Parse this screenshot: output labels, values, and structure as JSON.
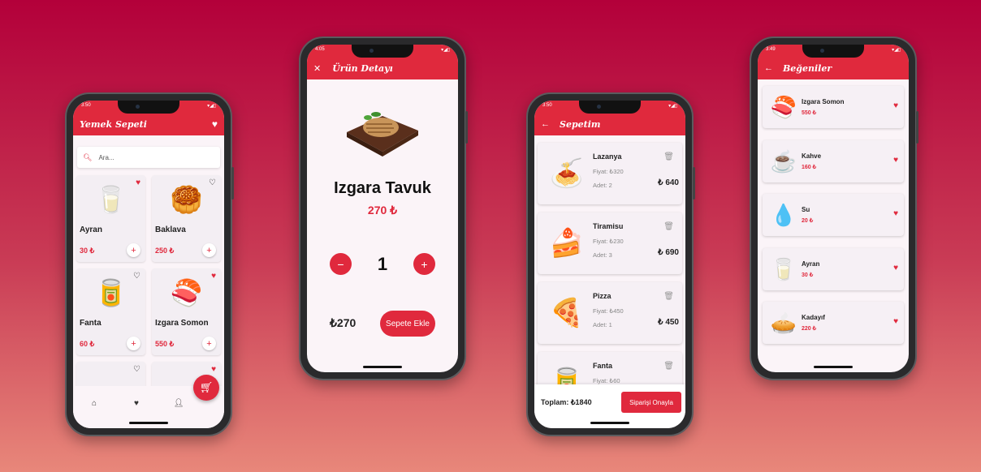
{
  "colors": {
    "accent": "#e0293d",
    "bg_top": "#b3003a",
    "bg_bottom": "#e8877a"
  },
  "home": {
    "status_time": "3:50",
    "title": "Yemek Sepeti",
    "search_placeholder": "Ara...",
    "products": [
      {
        "name": "Ayran",
        "price": "30 ₺",
        "fav": true,
        "icon": "ayran-cup-icon",
        "glyph": "🥛"
      },
      {
        "name": "Baklava",
        "price": "250 ₺",
        "fav": false,
        "icon": "baklava-icon",
        "glyph": "🥮"
      },
      {
        "name": "Fanta",
        "price": "60 ₺",
        "fav": false,
        "icon": "fanta-can-icon",
        "glyph": "🥫"
      },
      {
        "name": "Izgara Somon",
        "price": "550 ₺",
        "fav": true,
        "icon": "salmon-plate-icon",
        "glyph": "🍣"
      }
    ],
    "nav": [
      "home-icon",
      "favorites-icon",
      "profile-icon"
    ]
  },
  "detail": {
    "status_time": "4:05",
    "title": "Ürün Detayı",
    "name": "Izgara Tavuk",
    "price": "270 ₺",
    "quantity": "1",
    "total": "₺270",
    "add_label": "Sepete Ekle"
  },
  "cart": {
    "status_time": "3:50",
    "title": "Sepetim",
    "items": [
      {
        "name": "Lazanya",
        "price": "Fiyat: ₺320",
        "qty": "Adet: 2",
        "total": "₺ 640",
        "glyph": "🍝"
      },
      {
        "name": "Tiramisu",
        "price": "Fiyat: ₺230",
        "qty": "Adet: 3",
        "total": "₺ 690",
        "glyph": "🍰"
      },
      {
        "name": "Pizza",
        "price": "Fiyat: ₺450",
        "qty": "Adet: 1",
        "total": "₺ 450",
        "glyph": "🍕"
      },
      {
        "name": "Fanta",
        "price": "Fiyat: ₺60",
        "qty": "",
        "total": "",
        "glyph": "🥫"
      }
    ],
    "total": "Toplam: ₺1840",
    "confirm_label": "Siparişi Onayla"
  },
  "favorites": {
    "status_time": "3:49",
    "title": "Beğeniler",
    "items": [
      {
        "name": "Izgara Somon",
        "price": "550 ₺",
        "glyph": "🍣"
      },
      {
        "name": "Kahve",
        "price": "160 ₺",
        "glyph": "☕"
      },
      {
        "name": "Su",
        "price": "20 ₺",
        "glyph": "💧"
      },
      {
        "name": "Ayran",
        "price": "30 ₺",
        "glyph": "🥛"
      },
      {
        "name": "Kadayıf",
        "price": "220 ₺",
        "glyph": "🥧"
      }
    ]
  }
}
